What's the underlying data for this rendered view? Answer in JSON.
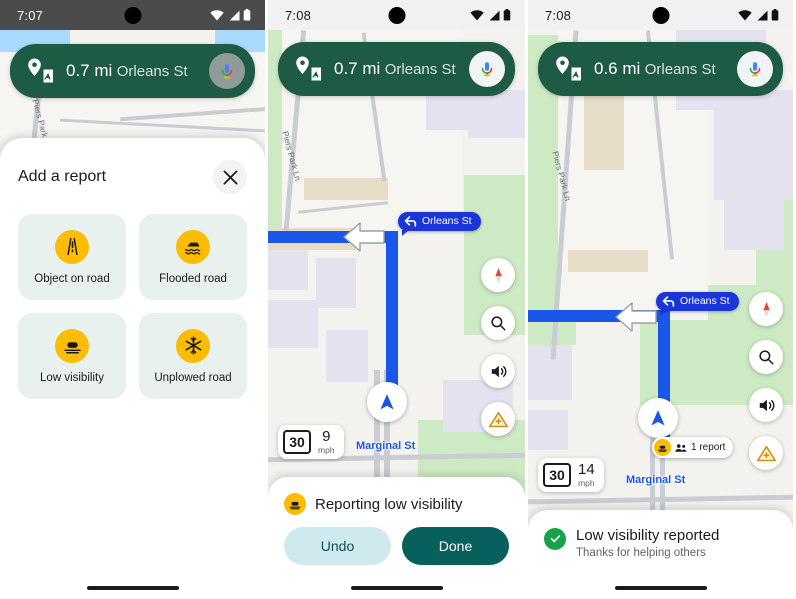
{
  "panels": [
    {
      "id": "report-picker",
      "status": {
        "time": "7:07",
        "wifi_icon": "wifi-icon",
        "signal_icon": "signal-icon",
        "battery_icon": "battery-icon",
        "camera_icon": "front-camera-punch-hole"
      },
      "nav": {
        "distance": "0.7 mi",
        "street": "Orleans St",
        "pin_icon": "destination-pin-icon",
        "mic_icon": "google-assistant-mic-icon"
      },
      "sheet": {
        "title": "Add a report",
        "close_icon": "close-icon",
        "cards": [
          {
            "label": "Object on road",
            "icon": "object-on-road-icon"
          },
          {
            "label": "Flooded road",
            "icon": "flooded-road-icon"
          },
          {
            "label": "Low visibility",
            "icon": "low-visibility-icon"
          },
          {
            "label": "Unplowed road",
            "icon": "unplowed-road-icon"
          }
        ]
      }
    },
    {
      "id": "reporting-confirm",
      "status": {
        "time": "7:08",
        "wifi_icon": "wifi-icon",
        "signal_icon": "signal-icon",
        "battery_icon": "battery-icon",
        "camera_icon": "front-camera-punch-hole"
      },
      "nav": {
        "distance": "0.7 mi",
        "street": "Orleans St",
        "pin_icon": "destination-pin-icon",
        "mic_icon": "google-assistant-mic-icon"
      },
      "map": {
        "turn_banner": {
          "label": "Orleans St",
          "icon": "turn-left-arrow-icon"
        },
        "street_vertical": "Piers Park Ln",
        "street_horizontal": "Marginal St",
        "compass_icon": "compass-icon",
        "search_icon": "search-icon",
        "volume_icon": "volume-on-icon",
        "report_icon": "add-report-icon",
        "puck_icon": "navigation-arrow-icon"
      },
      "speed": {
        "limit": "30",
        "current": "9",
        "unit": "mph"
      },
      "sheet": {
        "title": "Reporting low visibility",
        "badge_icon": "low-visibility-icon",
        "undo_label": "Undo",
        "done_label": "Done"
      }
    },
    {
      "id": "reported-success",
      "status": {
        "time": "7:08",
        "wifi_icon": "wifi-icon",
        "signal_icon": "signal-icon",
        "battery_icon": "battery-icon",
        "camera_icon": "front-camera-punch-hole"
      },
      "nav": {
        "distance": "0.6 mi",
        "street": "Orleans St",
        "pin_icon": "destination-pin-icon",
        "mic_icon": "google-assistant-mic-icon"
      },
      "map": {
        "turn_banner": {
          "label": "Orleans St",
          "icon": "turn-left-arrow-icon"
        },
        "street_vertical": "Piers Park Ln",
        "street_horizontal": "Marginal St",
        "compass_icon": "compass-icon",
        "search_icon": "search-icon",
        "volume_icon": "volume-on-icon",
        "report_icon": "add-report-icon",
        "puck_icon": "navigation-arrow-icon",
        "report_chip": {
          "label": "1 report",
          "icon": "low-visibility-icon",
          "people_icon": "people-icon"
        }
      },
      "speed": {
        "limit": "30",
        "current": "14",
        "unit": "mph"
      },
      "sheet": {
        "title": "Low visibility reported",
        "subtitle": "Thanks for helping others",
        "check_icon": "check-circle-icon"
      }
    }
  ],
  "colors": {
    "nav_green": "#1d5b44",
    "route_blue": "#1a56e8",
    "banner_blue": "#1a35d8",
    "report_yellow": "#fbbc04",
    "done_teal": "#08605d",
    "undo_light": "#cfeaef",
    "success_green": "#17a34a",
    "card_mint": "#e9f1ee",
    "park_green": "#cdeac4",
    "water_blue": "#aadaff"
  }
}
